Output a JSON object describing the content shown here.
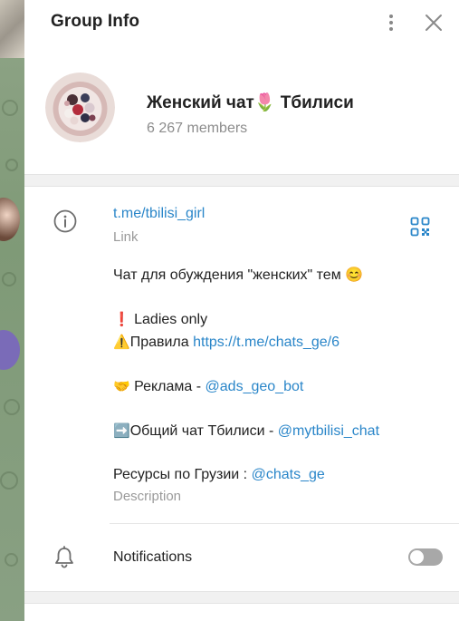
{
  "header": {
    "title": "Group Info",
    "more_icon": "more-vertical-icon",
    "close_icon": "close-icon"
  },
  "profile": {
    "group_name": "Женский чат🌷 Тбилиси",
    "member_count": "6 267 members"
  },
  "info": {
    "link": "t.me/tbilisi_girl",
    "link_label": "Link",
    "description_label": "Description",
    "description": {
      "line1": "Чат для обуждения \"женских\" тем 😊",
      "ladies_emoji": "❗",
      "ladies_text": " Ladies only",
      "rules_emoji": "⚠️",
      "rules_text": "Правила ",
      "rules_link": "https://t.me/chats_ge/6",
      "ads_emoji": "🤝",
      "ads_text": " Реклама - ",
      "ads_link": "@ads_geo_bot",
      "chat_emoji": "➡️",
      "chat_text": "Общий чат Тбилиси - ",
      "chat_link": "@mytbilisi_chat",
      "resources_text": "Ресурсы по Грузии : ",
      "resources_link": "@chats_ge"
    }
  },
  "notifications": {
    "label": "Notifications",
    "enabled": false
  },
  "colors": {
    "accent": "#2a86c9",
    "secondary_text": "#8c8c8c",
    "toggle_off": "#a8a8a8"
  }
}
